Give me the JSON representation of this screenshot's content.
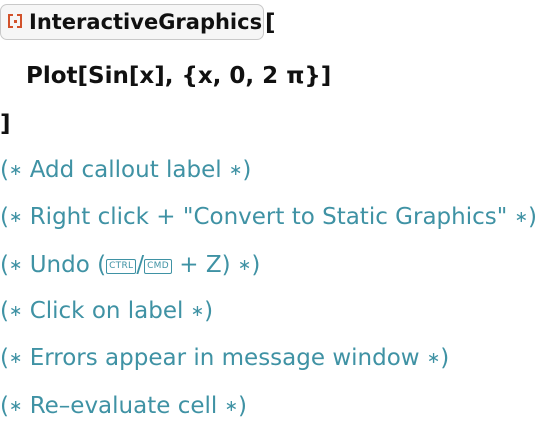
{
  "input_cell": {
    "function_name": "InteractiveGraphics",
    "open_bracket": "[",
    "argument": "Plot[Sin[x], {x, 0, 2 π}]",
    "close_bracket": "]"
  },
  "comments": [
    {
      "open": "(",
      "star": "∗",
      "text": " Add callout label ",
      "close": ")"
    },
    {
      "open": "(",
      "star": "∗",
      "text": " Right click + \"Convert to Static Graphics\" ",
      "close": ")"
    },
    {
      "open": "(",
      "star": "∗",
      "text_before": " Undo (",
      "key1": "CTRL",
      "separator": "/",
      "key2": "CMD",
      "text_after": " + Z) ",
      "close": ")"
    },
    {
      "open": "(",
      "star": "∗",
      "text": " Click on label ",
      "close": ")"
    },
    {
      "open": "(",
      "star": "∗",
      "text": " Errors appear in message window ",
      "close": ")"
    },
    {
      "open": "(",
      "star": "∗",
      "text": " Re–evaluate cell ",
      "close": ")"
    }
  ],
  "colors": {
    "code": "#111111",
    "comment": "#3f92a4",
    "badge_icon": "#d2522b"
  },
  "icons": {
    "function_badge": "wolfram-function-icon"
  }
}
